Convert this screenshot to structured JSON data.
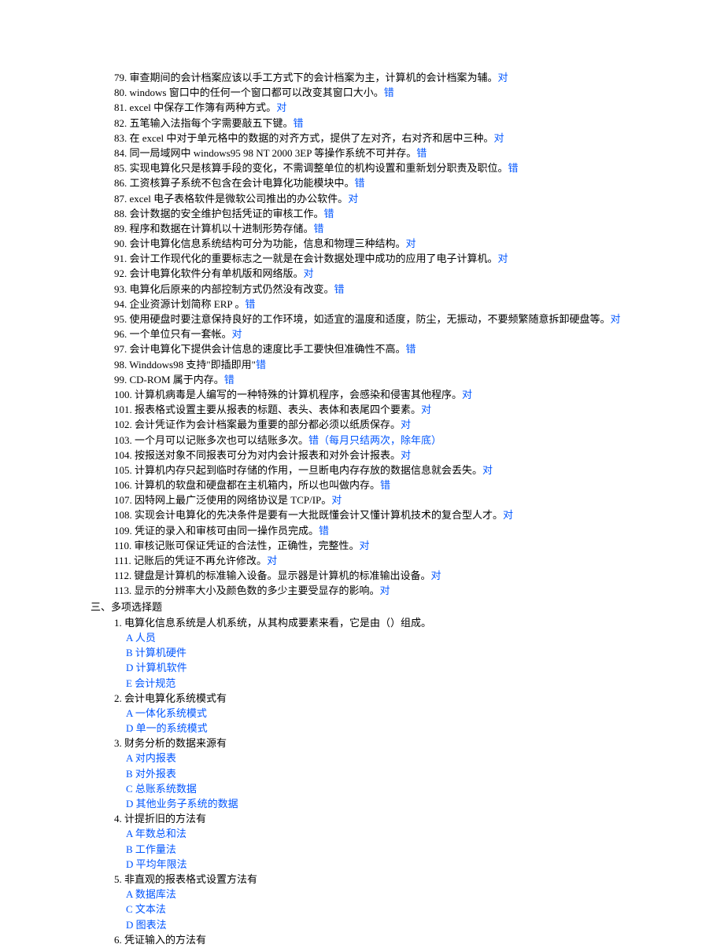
{
  "tfItems": [
    {
      "num": "79",
      "text": "审查期间的会计档案应该以手工方式下的会计档案为主，计算机的会计档案为辅。",
      "answer": "对",
      "note": ""
    },
    {
      "num": "80",
      "text": "windows 窗口中的任何一个窗口都可以改变其窗口大小。",
      "answer": "错",
      "note": ""
    },
    {
      "num": "81",
      "text": "excel 中保存工作簿有两种方式。",
      "answer": "对",
      "note": ""
    },
    {
      "num": "82",
      "text": "五笔输入法指每个字需要敲五下键。",
      "answer": "错",
      "note": ""
    },
    {
      "num": "83",
      "text": "在 excel 中对于单元格中的数据的对齐方式，提供了左对齐，右对齐和居中三种。",
      "answer": "对",
      "note": ""
    },
    {
      "num": "84",
      "text": "同一局域网中 windows95 98 NT 2000 3EP 等操作系统不可并存。",
      "answer": "错",
      "note": ""
    },
    {
      "num": "85",
      "text": "实现电算化只是核算手段的变化，不需调整单位的机构设置和重新划分职责及职位。",
      "answer": "错",
      "note": ""
    },
    {
      "num": "86",
      "text": "工资核算子系统不包含在会计电算化功能模块中。",
      "answer": "错",
      "note": ""
    },
    {
      "num": "87",
      "text": "excel 电子表格软件是微软公司推出的办公软件。",
      "answer": "对",
      "note": ""
    },
    {
      "num": "88",
      "text": "会计数据的安全维护包括凭证的审核工作。",
      "answer": "错",
      "note": ""
    },
    {
      "num": "89",
      "text": "程序和数据在计算机以十进制形势存储。",
      "answer": "错",
      "note": ""
    },
    {
      "num": "90",
      "text": "会计电算化信息系统结构可分为功能，信息和物理三种结构。",
      "answer": "对",
      "note": ""
    },
    {
      "num": "91",
      "text": "会计工作现代化的重要标志之一就是在会计数据处理中成功的应用了电子计算机。",
      "answer": "对",
      "note": ""
    },
    {
      "num": "92",
      "text": "会计电算化软件分有单机版和网络版。",
      "answer": "对",
      "note": ""
    },
    {
      "num": "93",
      "text": "电算化后原来的内部控制方式仍然没有改变。",
      "answer": "错",
      "note": ""
    },
    {
      "num": "94",
      "text": "企业资源计划简称 ERP 。",
      "answer": "错",
      "note": ""
    },
    {
      "num": "95",
      "text": "使用硬盘时要注意保持良好的工作环境，如适宜的温度和适度，防尘，无振动，不要频繁随意拆卸硬盘等。",
      "answer": "对",
      "note": ""
    },
    {
      "num": "96",
      "text": "一个单位只有一套帐。",
      "answer": "对",
      "note": ""
    },
    {
      "num": "97",
      "text": "会计电算化下提供会计信息的速度比手工要快但准确性不高。",
      "answer": "错",
      "note": ""
    },
    {
      "num": "98",
      "text": "Winddows98 支持\"即插即用\"",
      "answer": "错",
      "note": ""
    },
    {
      "num": "99",
      "text": "CD-ROM 属于内存。",
      "answer": "错",
      "note": ""
    },
    {
      "num": "100",
      "text": "计算机病毒是人编写的一种特殊的计算机程序，会感染和侵害其他程序。",
      "answer": "对",
      "note": ""
    },
    {
      "num": "101",
      "text": "报表格式设置主要从报表的标题、表头、表体和表尾四个要素。",
      "answer": "对",
      "note": ""
    },
    {
      "num": "102",
      "text": "会计凭证作为会计档案最为重要的部分都必须以纸质保存。",
      "answer": "对",
      "note": ""
    },
    {
      "num": "103",
      "text": "一个月可以记账多次也可以结账多次。",
      "answer": "错",
      "note": "（每月只结两次，除年底）"
    },
    {
      "num": "104",
      "text": "按报送对象不同报表可分为对内会计报表和对外会计报表。",
      "answer": "对",
      "note": ""
    },
    {
      "num": "105",
      "text": "计算机内存只起到临时存储的作用，一旦断电内存存放的数据信息就会丢失。",
      "answer": "对",
      "note": ""
    },
    {
      "num": "106",
      "text": "计算机的软盘和硬盘都在主机箱内，所以也叫做内存。",
      "answer": "错",
      "note": ""
    },
    {
      "num": "107",
      "text": "因特网上最广泛使用的网络协议是 TCP/IP。",
      "answer": "对",
      "note": ""
    },
    {
      "num": "108",
      "text": "实现会计电算化的先决条件是要有一大批既懂会计又懂计算机技术的复合型人才。",
      "answer": "对",
      "note": ""
    },
    {
      "num": "109",
      "text": "凭证的录入和审核可由同一操作员完成。",
      "answer": "错",
      "note": ""
    },
    {
      "num": "110",
      "text": "审核记账可保证凭证的合法性，正确性，完整性。",
      "answer": "对",
      "note": ""
    },
    {
      "num": "111",
      "text": "记账后的凭证不再允许修改。",
      "answer": "对",
      "note": ""
    },
    {
      "num": "112",
      "text": "键盘是计算机的标准输入设备。显示器是计算机的标准输出设备。",
      "answer": "对",
      "note": ""
    },
    {
      "num": "113",
      "text": "显示的分辨率大小及颜色数的多少主要受显存的影响。",
      "answer": "对",
      "note": ""
    }
  ],
  "sectionTitle": "三、多项选择题",
  "mcItems": [
    {
      "num": "1",
      "question": "电算化信息系统是人机系统，从其构成要素来看，它是由（）组成。",
      "options": [
        "A 人员",
        "B 计算机硬件",
        "D 计算机软件",
        "E 会计规范"
      ]
    },
    {
      "num": "2",
      "question": "会计电算化系统模式有",
      "options": [
        "A 一体化系统模式",
        "D 单一的系统模式"
      ]
    },
    {
      "num": "3",
      "question": "财务分析的数据来源有",
      "options": [
        "A 对内报表",
        "B 对外报表",
        "C 总账系统数据",
        "D 其他业务子系统的数据"
      ]
    },
    {
      "num": "4",
      "question": "计提折旧的方法有",
      "options": [
        "A 年数总和法",
        "B 工作量法",
        "D 平均年限法"
      ]
    },
    {
      "num": "5",
      "question": "非直观的报表格式设置方法有",
      "options": [
        "A 数据库法",
        "C 文本法",
        "D 图表法"
      ]
    },
    {
      "num": "6",
      "question": "凭证输入的方法有",
      "options": []
    }
  ]
}
